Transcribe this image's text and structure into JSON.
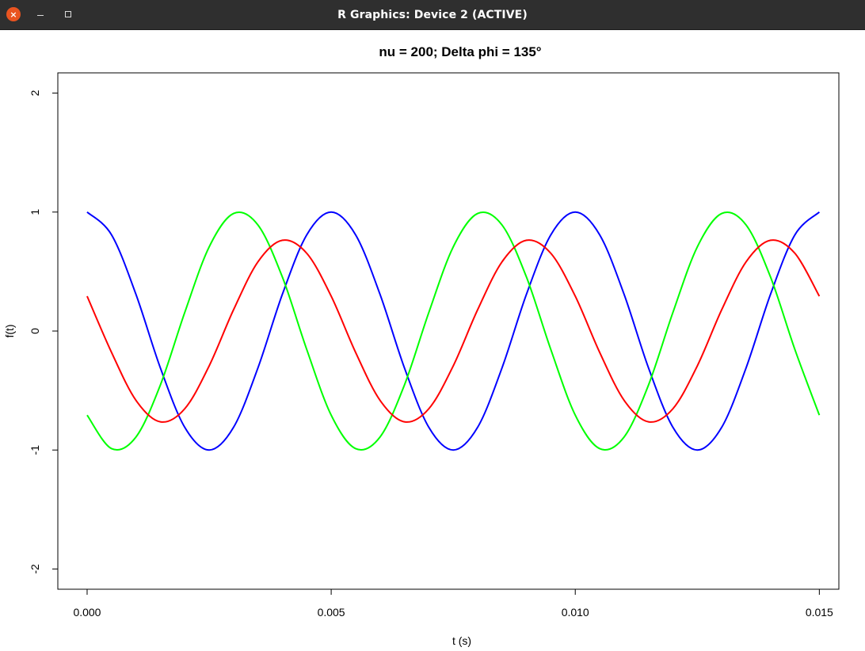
{
  "window": {
    "title": "R Graphics: Device 2 (ACTIVE)",
    "close_glyph": "×"
  },
  "chart_data": {
    "type": "line",
    "title": "nu = 200;   Delta phi = 135°",
    "xlabel": "t  (s)",
    "ylabel": "f(t)",
    "xlim": [
      -0.0006,
      0.0154
    ],
    "ylim": [
      -2.17,
      2.17
    ],
    "x_ticks": [
      0.0,
      0.005,
      0.01,
      0.015
    ],
    "x_tick_labels": [
      "0.000",
      "0.005",
      "0.010",
      "0.015"
    ],
    "y_ticks": [
      -2,
      -1,
      0,
      1,
      2
    ],
    "y_tick_labels": [
      "-2",
      "-1",
      "0",
      "1",
      "2"
    ],
    "grid": false,
    "line_width": 2,
    "series": [
      {
        "color": "#0000ff",
        "x": [
          0.0,
          0.0005,
          0.001,
          0.0015,
          0.002,
          0.0025,
          0.003,
          0.0035,
          0.004,
          0.0045,
          0.005,
          0.0055,
          0.006,
          0.0065,
          0.007,
          0.0075,
          0.008,
          0.0085,
          0.009,
          0.0095,
          0.01,
          0.0105,
          0.011,
          0.0115,
          0.012,
          0.0125,
          0.013,
          0.0135,
          0.014,
          0.0145,
          0.015
        ],
        "y": [
          1.0,
          0.809,
          0.309,
          -0.309,
          -0.809,
          -1.0,
          -0.809,
          -0.309,
          0.309,
          0.809,
          1.0,
          0.809,
          0.309,
          -0.309,
          -0.809,
          -1.0,
          -0.809,
          -0.309,
          0.309,
          0.809,
          1.0,
          0.809,
          0.309,
          -0.309,
          -0.809,
          -1.0,
          -0.809,
          -0.309,
          0.309,
          0.809,
          1.0
        ]
      },
      {
        "color": "#00ff00",
        "x": [
          0.0,
          0.0005,
          0.001,
          0.0015,
          0.002,
          0.0025,
          0.003,
          0.0035,
          0.004,
          0.0045,
          0.005,
          0.0055,
          0.006,
          0.0065,
          0.007,
          0.0075,
          0.008,
          0.0085,
          0.009,
          0.0095,
          0.01,
          0.0105,
          0.011,
          0.0115,
          0.012,
          0.0125,
          0.013,
          0.0135,
          0.014,
          0.0145,
          0.015
        ],
        "y": [
          -0.707,
          -0.988,
          -0.891,
          -0.454,
          0.156,
          0.707,
          0.988,
          0.891,
          0.454,
          -0.156,
          -0.707,
          -0.988,
          -0.891,
          -0.454,
          0.156,
          0.707,
          0.988,
          0.891,
          0.454,
          -0.156,
          -0.707,
          -0.988,
          -0.891,
          -0.454,
          0.156,
          0.707,
          0.988,
          0.891,
          0.454,
          -0.156,
          -0.707
        ]
      },
      {
        "color": "#ff0000",
        "x": [
          0.0,
          0.0005,
          0.001,
          0.0015,
          0.002,
          0.0025,
          0.003,
          0.0035,
          0.004,
          0.0045,
          0.005,
          0.0055,
          0.006,
          0.0065,
          0.007,
          0.0075,
          0.008,
          0.0085,
          0.009,
          0.0095,
          0.01,
          0.0105,
          0.011,
          0.0115,
          0.012,
          0.0125,
          0.013,
          0.0135,
          0.014,
          0.0145,
          0.015
        ],
        "y": [
          0.293,
          -0.179,
          -0.582,
          -0.763,
          -0.653,
          -0.293,
          0.179,
          0.582,
          0.763,
          0.653,
          0.293,
          -0.179,
          -0.582,
          -0.763,
          -0.653,
          -0.293,
          0.179,
          0.582,
          0.763,
          0.653,
          0.293,
          -0.179,
          -0.582,
          -0.763,
          -0.653,
          -0.293,
          0.179,
          0.582,
          0.763,
          0.653,
          0.293
        ]
      }
    ]
  }
}
